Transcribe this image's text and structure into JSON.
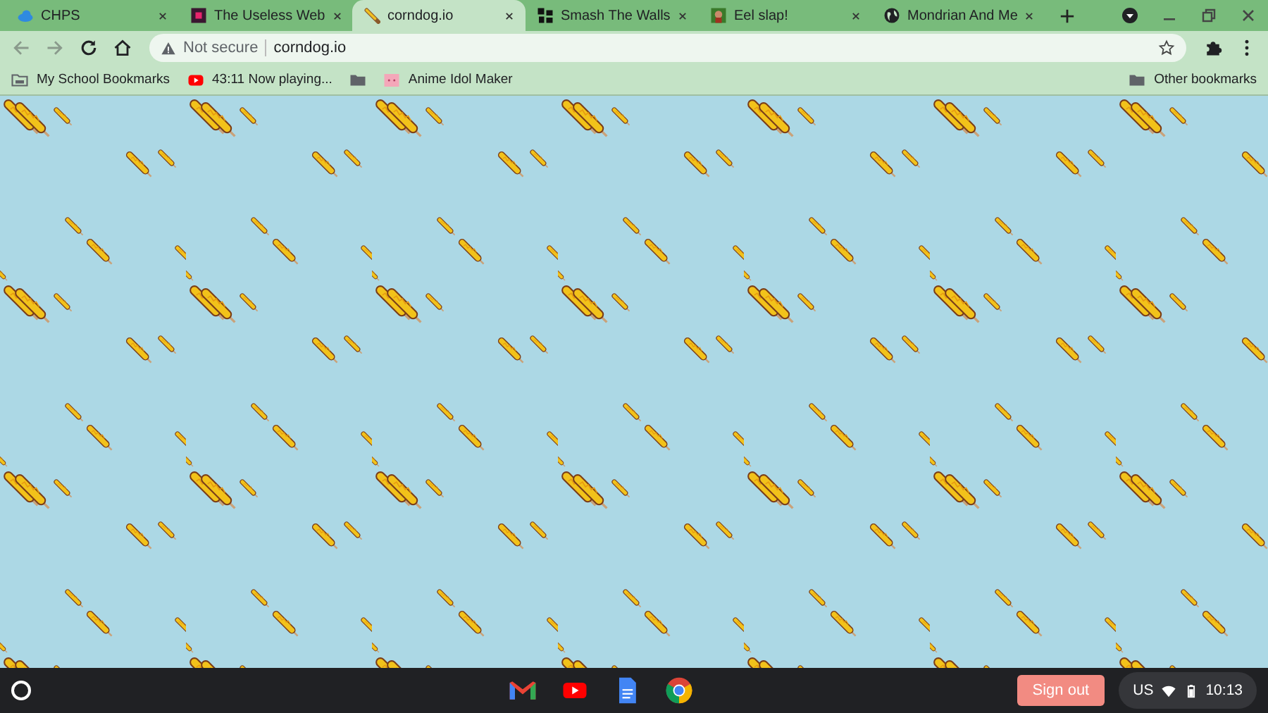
{
  "tabs": [
    {
      "title": "CHPS",
      "selected": false
    },
    {
      "title": "The Useless Web",
      "selected": false
    },
    {
      "title": "corndog.io",
      "selected": true
    },
    {
      "title": "Smash The Walls",
      "selected": false
    },
    {
      "title": "Eel slap!",
      "selected": false
    },
    {
      "title": "Mondrian And Me",
      "selected": false
    }
  ],
  "address_bar": {
    "security": "Not secure",
    "url": "corndog.io"
  },
  "bookmarks": [
    {
      "label": "My School Bookmarks"
    },
    {
      "label": "43:11 Now playing..."
    },
    {
      "label": "Anime Idol Maker"
    }
  ],
  "other_bookmarks": "Other bookmarks",
  "shelf": {
    "sign_out": "Sign out",
    "locale": "US",
    "time": "10:13"
  }
}
